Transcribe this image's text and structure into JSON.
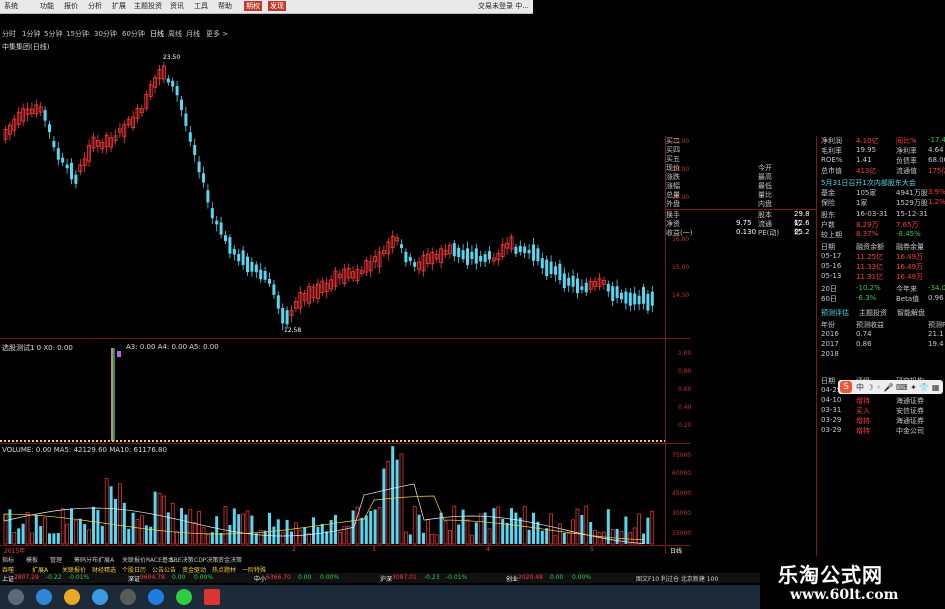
{
  "menu": {
    "items": [
      "系统",
      "功能",
      "报价",
      "分析",
      "扩展",
      "主题投资",
      "资讯",
      "工具",
      "帮助"
    ],
    "highlight1": "期权",
    "highlight2": "发现",
    "right_text": "交易未登录  中..."
  },
  "periods": {
    "items": [
      "分时",
      "1分钟",
      "5分钟",
      "15分钟",
      "30分钟",
      "60分钟",
      "日线",
      "周线",
      "月线",
      "更多 >"
    ],
    "active": "日线"
  },
  "stock_title": "中集集团(日线)",
  "main_chart": {
    "high_label": "23.50",
    "low_label": "12.58",
    "y_ticks": [
      "19.00",
      "18.00",
      "17.00",
      "16.00",
      "15.00",
      "14.30"
    ]
  },
  "indicator": {
    "title": "选股测试1 0 X0: 0.00",
    "extra": "A3: 0.00  A4: 0.00  A5: 0.00",
    "y_ticks": [
      "1.00",
      "0.80",
      "0.60",
      "0.40",
      "0.20"
    ]
  },
  "volume": {
    "title": "VOLUME: 0.00  MA5: 42129.60  MA10: 61176.80",
    "y_ticks": [
      "75000",
      "60000",
      "45000",
      "30000",
      "15000"
    ],
    "x_labels": [
      "2015年",
      "2",
      "3",
      "4",
      "5",
      "日线"
    ]
  },
  "quote": {
    "rows": [
      {
        "k": "买二",
        "v": "",
        "k2": "",
        "v2": ""
      },
      {
        "k": "买四",
        "v": "",
        "k2": "",
        "v2": ""
      },
      {
        "k": "买五",
        "v": "",
        "k2": "",
        "v2": ""
      },
      {
        "k": "现价",
        "v": "",
        "k2": "今开",
        "v2": ""
      },
      {
        "k": "涨跌",
        "v": "",
        "k2": "最高",
        "v2": ""
      },
      {
        "k": "涨幅",
        "v": "",
        "k2": "最低",
        "v2": ""
      },
      {
        "k": "总量",
        "v": "",
        "k2": "量比",
        "v2": ""
      },
      {
        "k": "外盘",
        "v": "",
        "k2": "内盘",
        "v2": ""
      },
      {
        "k": "换手",
        "v": "",
        "k2": "股本",
        "v2": "29.8亿"
      },
      {
        "k": "净资",
        "v": "9.75",
        "k2": "流通",
        "v2": "12.6亿"
      },
      {
        "k": "收益(一)",
        "v": "0.130",
        "k2": "PE(动)",
        "v2": "25.2"
      }
    ]
  },
  "fundamentals": {
    "rows": [
      [
        "净利润",
        "4.10亿",
        "同比%",
        "-17.49"
      ],
      [
        "毛利率",
        "19.95",
        "净利率",
        "4.64"
      ],
      [
        "ROE%",
        "1.41",
        "负债率",
        "68.00"
      ],
      [
        "总市值",
        "413亿",
        "流通值",
        "175亿"
      ],
      [
        "5月31日召开1次内部股东大会",
        "",
        "",
        ""
      ],
      [
        "基金",
        "105家",
        "4941万股",
        "3.9%"
      ],
      [
        "保险",
        "1家",
        "1529万股",
        "1.2%"
      ],
      [
        "股东",
        "16-03-31",
        "15-12-31",
        ""
      ],
      [
        "户数",
        "8.29万",
        "7.65万",
        ""
      ],
      [
        "较上期",
        "8.37%",
        "-8.45%",
        ""
      ],
      [
        "日期",
        "融资余额",
        "融券余量",
        ""
      ],
      [
        "05-17",
        "11.25亿",
        "16.49万",
        ""
      ],
      [
        "05-16",
        "11.33亿",
        "16.49万",
        ""
      ],
      [
        "05-13",
        "11.31亿",
        "16.49万",
        ""
      ],
      [
        "20日",
        "-10.2%",
        "今年来",
        "-34.0%"
      ],
      [
        "60日",
        "-6.3%",
        "Beta值",
        "0.96"
      ]
    ],
    "tabs": [
      "预测评估",
      "主题投资",
      "智能解盘"
    ],
    "forecast_header": [
      "年份",
      "预测收益",
      "预测PE"
    ],
    "forecast_rows": [
      [
        "2016",
        "0.74",
        "21.1"
      ],
      [
        "2017",
        "0.86",
        "19.4"
      ],
      [
        "2018",
        "",
        ""
      ]
    ],
    "rating_header": [
      "日期",
      "评级",
      "研究机构"
    ],
    "rating_rows": [
      [
        "04-29",
        "增持",
        "中金公司"
      ],
      [
        "04-10",
        "增持",
        "海通证券"
      ],
      [
        "03-31",
        "买入",
        "安信证券"
      ],
      [
        "03-29",
        "增持",
        "海通证券"
      ],
      [
        "03-29",
        "增持",
        "中金公司"
      ]
    ]
  },
  "bottom_tabs": [
    "指标",
    "模板",
    "管理",
    "筹码分布",
    "扩展A",
    "关联报价",
    "RACE基本",
    "SBE决策",
    "CDP决策",
    "资金决策"
  ],
  "bottom_tabs2": [
    "吞噬",
    "扩展A",
    "关联报价",
    "财经精选",
    "个股日历",
    "公告公告",
    "资金驱动",
    "热点题材",
    "一阶特殊"
  ],
  "ticker": {
    "items": [
      {
        "name": "上证",
        "value": "2807.29",
        "chg": "-0.22",
        "pct": "-0.01%"
      },
      {
        "name": "深证",
        "value": "9694.78",
        "chg": "0.00",
        "pct": "0.00%"
      },
      {
        "name": "中小",
        "value": "6366.70",
        "chg": "0.00",
        "pct": "0.00%"
      },
      {
        "name": "沪深",
        "value": "3087.01",
        "chg": "-0.23",
        "pct": "-0.01%"
      },
      {
        "name": "创业",
        "value": "2020.48",
        "chg": "0.00",
        "pct": "0.00%"
      }
    ],
    "right": "图文F10  利过仓  北京新建  100"
  },
  "watermark": {
    "line1": "乐淘公式网",
    "line2": "www.60lt.com"
  },
  "colors": {
    "up": "#ff3b3b",
    "down": "#5ad6f0",
    "axis": "#7a1a1a",
    "signal": "#f5d442"
  }
}
